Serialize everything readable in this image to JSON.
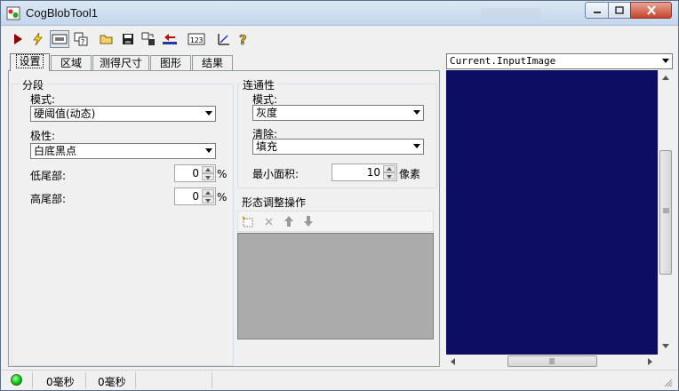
{
  "window": {
    "title": "CogBlobTool1"
  },
  "toolbar": {
    "buttons": [
      "run-icon",
      "electric-icon",
      "show-image-icon",
      "help-image-icon",
      "open-icon",
      "save-icon",
      "reset-icon",
      "import-icon",
      "numeric-icon",
      "measure-icon",
      "help-icon"
    ]
  },
  "tabs": [
    "设置",
    "区域",
    "测得尺寸",
    "图形",
    "结果"
  ],
  "segmentation": {
    "title": "分段",
    "mode_label": "模式:",
    "mode_value": "硬阈值(动态)",
    "polarity_label": "极性:",
    "polarity_value": "白底黑点",
    "low_tail_label": "低尾部:",
    "low_tail_value": "0",
    "high_tail_label": "高尾部:",
    "high_tail_value": "0",
    "unit": "%"
  },
  "connectivity": {
    "title": "连通性",
    "mode_label": "模式:",
    "mode_value": "灰度",
    "cleanup_label": "清除:",
    "cleanup_value": "填充",
    "min_area_label": "最小面积:",
    "min_area_value": "10",
    "min_area_unit": "像素"
  },
  "morphology": {
    "title": "形态调整操作"
  },
  "image_pane": {
    "selected": "Current.InputImage",
    "background": "#0d0d63"
  },
  "status": {
    "indicator_color": "#00c000",
    "time1": "0毫秒",
    "time2": "0毫秒"
  }
}
